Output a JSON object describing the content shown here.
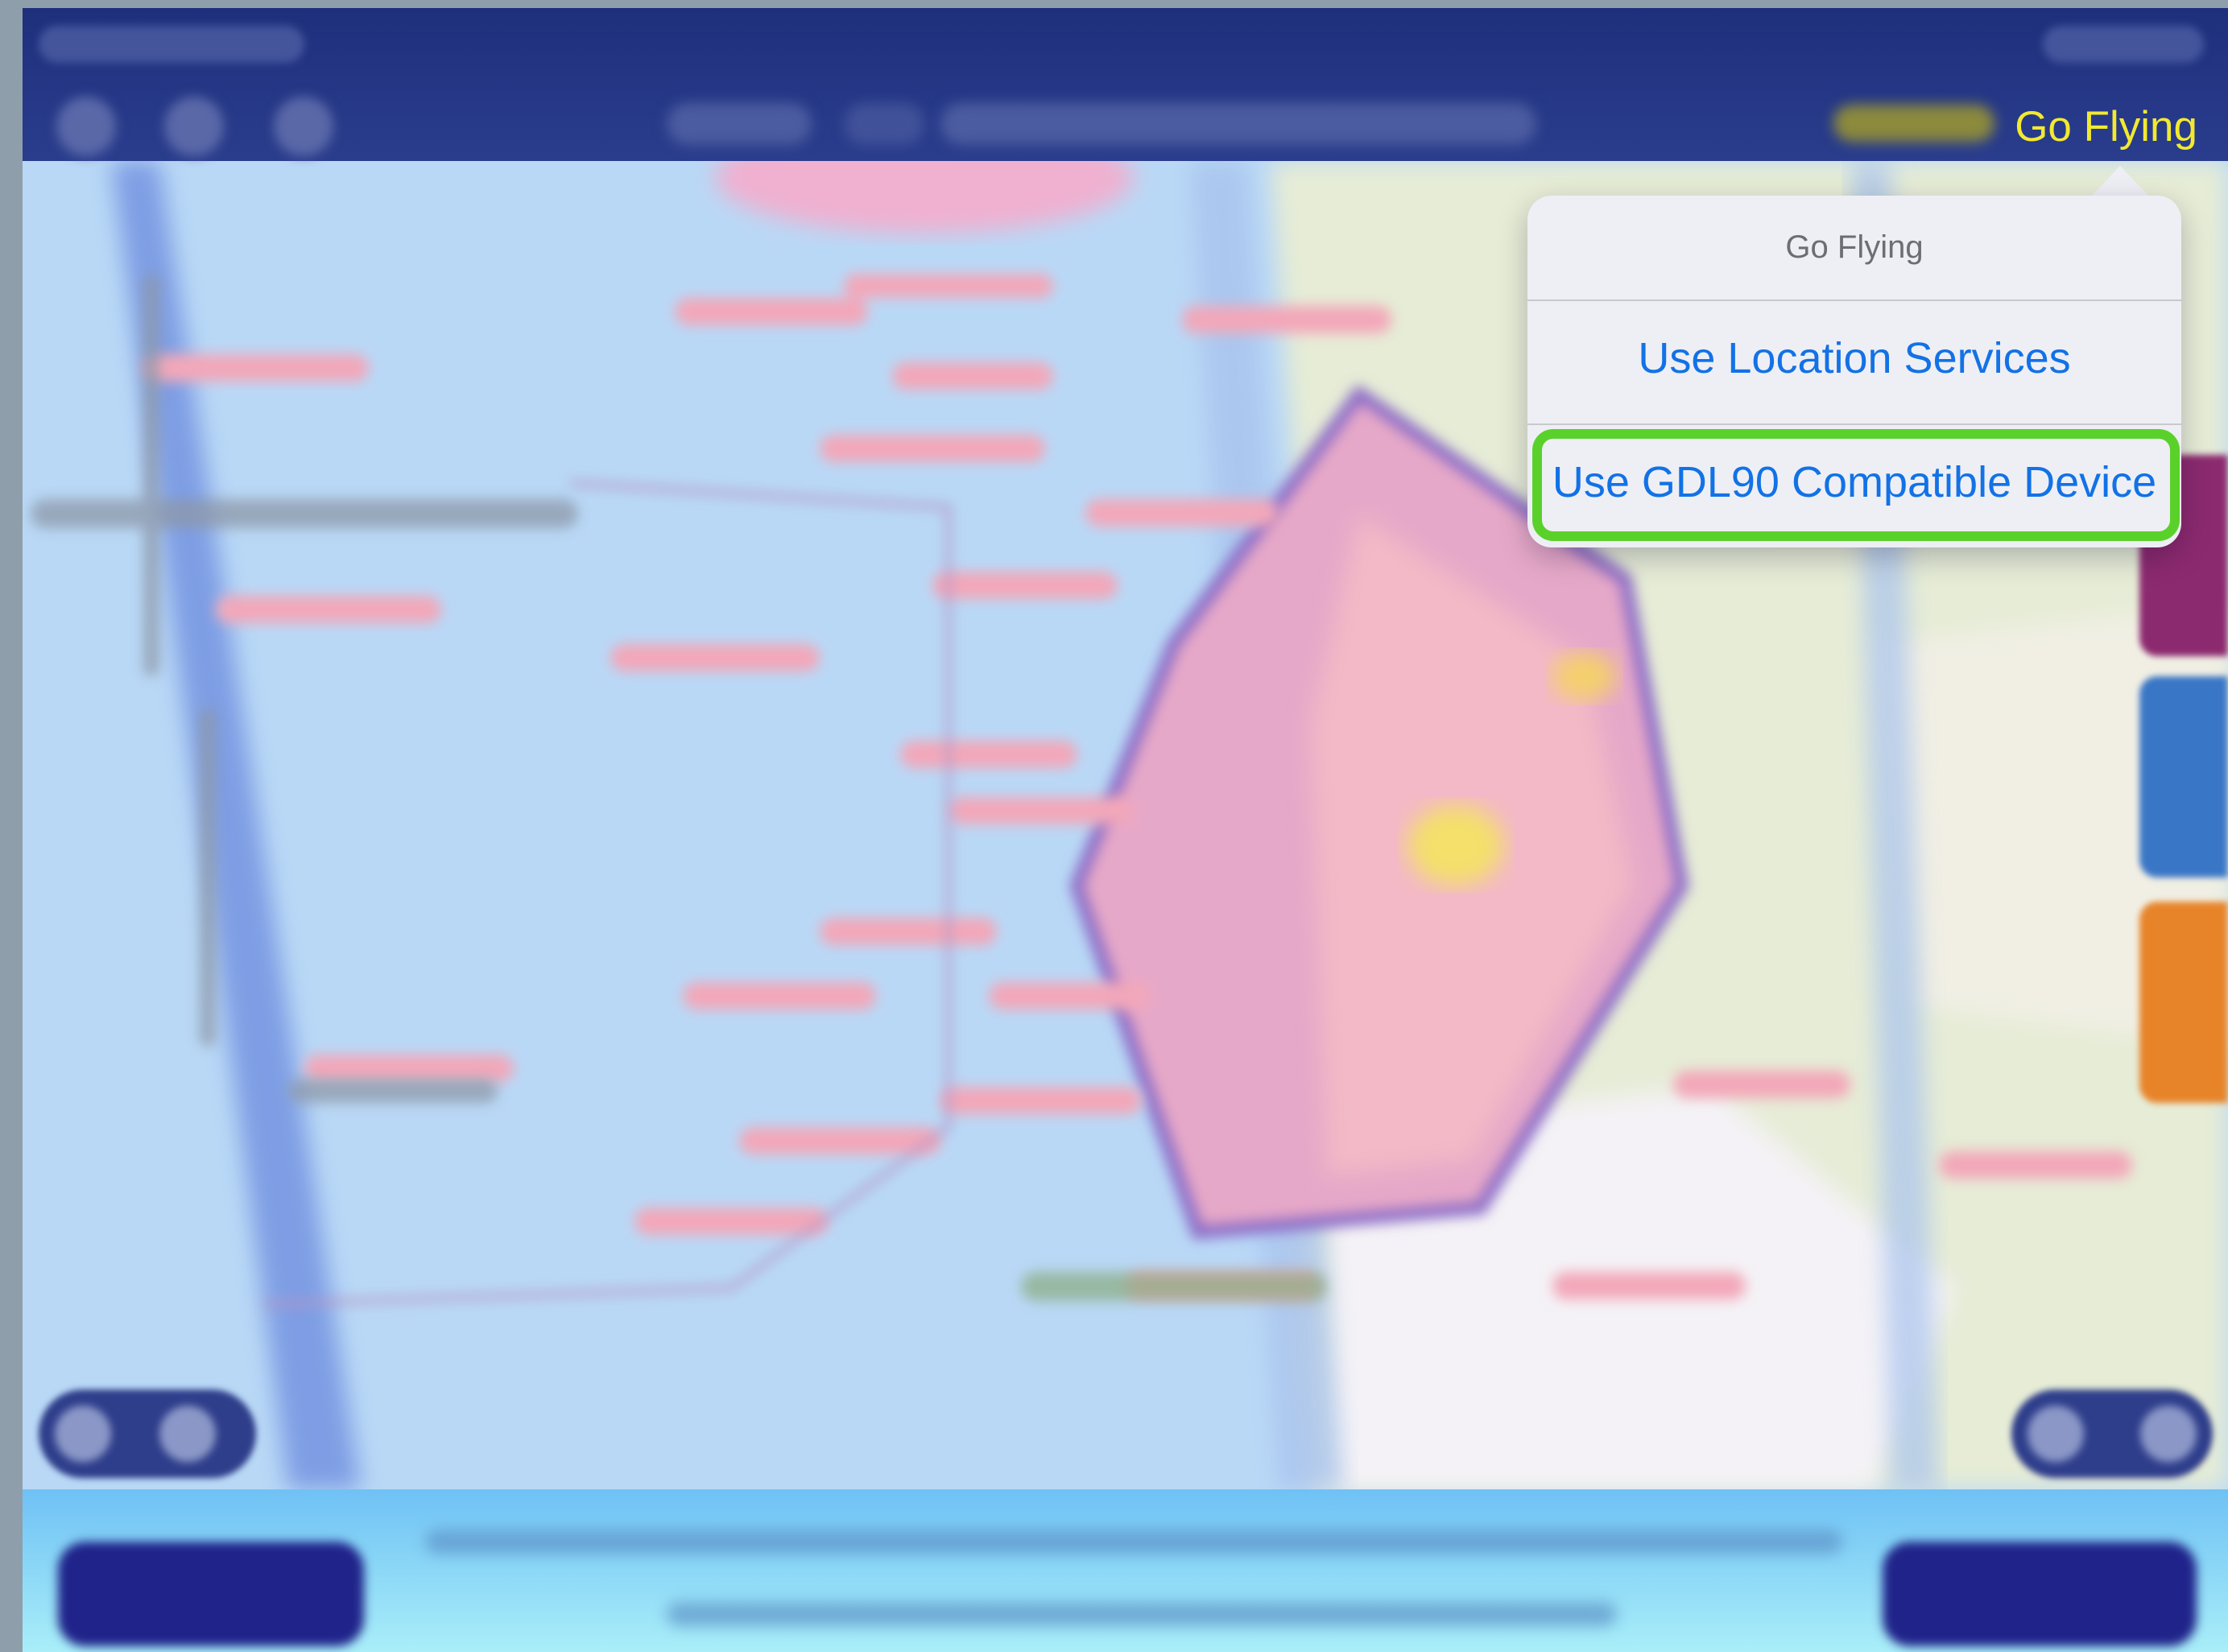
{
  "navigation": {
    "go_flying_label": "Go Flying",
    "go_flying_color": "#f2e930",
    "bar_color": "#24368a"
  },
  "popover": {
    "title": "Go Flying",
    "options": [
      {
        "label": "Use Location Services"
      },
      {
        "label": "Use GDL90 Compatible Device",
        "highlighted": true
      }
    ],
    "highlight_color": "#5ad12b",
    "option_text_color": "#1272e6"
  },
  "map": {
    "blurred": true,
    "water_color": "#b9d8f6",
    "airspace_color": "#e6a8c8"
  },
  "side_tabs": [
    {
      "color": "#8c2a6f"
    },
    {
      "color": "#3a76c6"
    },
    {
      "color": "#e7842a"
    }
  ],
  "bottom_bar": {
    "blurred": true,
    "gradient_top": "#6fc1f5",
    "gradient_bottom": "#a9eef8"
  }
}
